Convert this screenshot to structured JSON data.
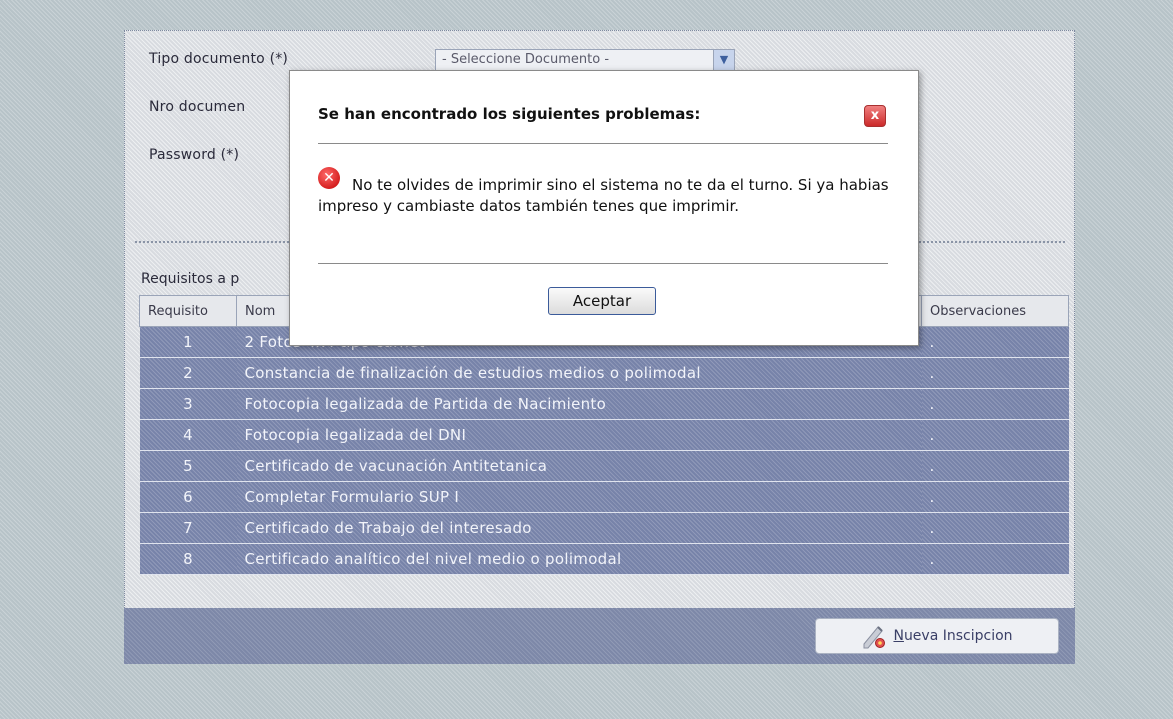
{
  "form": {
    "tipo_documento_label": "Tipo documento (*)",
    "nro_documento_label": "Nro documen",
    "password_label": "Password (*)",
    "tipo_documento_select": "- Seleccione Documento -",
    "requisitos_title": "Requisitos a p"
  },
  "table": {
    "headers": [
      "Requisito",
      "Nom",
      "Observaciones"
    ],
    "rows": [
      {
        "num": "1",
        "name": "2 Fotos 4x4 tipo carnet",
        "obs": "."
      },
      {
        "num": "2",
        "name": "Constancia de finalización de estudios medios o polimodal",
        "obs": "."
      },
      {
        "num": "3",
        "name": "Fotocopia legalizada de Partida de Nacimiento",
        "obs": "."
      },
      {
        "num": "4",
        "name": "Fotocopia legalizada del DNI",
        "obs": "."
      },
      {
        "num": "5",
        "name": "Certificado de vacunación Antitetanica",
        "obs": "."
      },
      {
        "num": "6",
        "name": "Completar Formulario SUP I",
        "obs": "."
      },
      {
        "num": "7",
        "name": "Certificado de Trabajo del interesado",
        "obs": "."
      },
      {
        "num": "8",
        "name": "Certificado analítico del nivel medio o polimodal",
        "obs": "."
      }
    ]
  },
  "footer": {
    "new_button_first": "N",
    "new_button_rest": "ueva Inscipcion"
  },
  "modal": {
    "title": "Se han encontrado los siguientes problemas:",
    "message": "No te olvides de imprimir sino el sistema no te da el turno. Si ya habias impreso y cambiaste datos también tenes que imprimir.",
    "ok_label": "Aceptar",
    "close_glyph": "x",
    "error_glyph": "✕"
  },
  "colors": {
    "table_row": "#7783a9",
    "footer_bar": "#7d88a8",
    "error_red": "#c40000"
  }
}
